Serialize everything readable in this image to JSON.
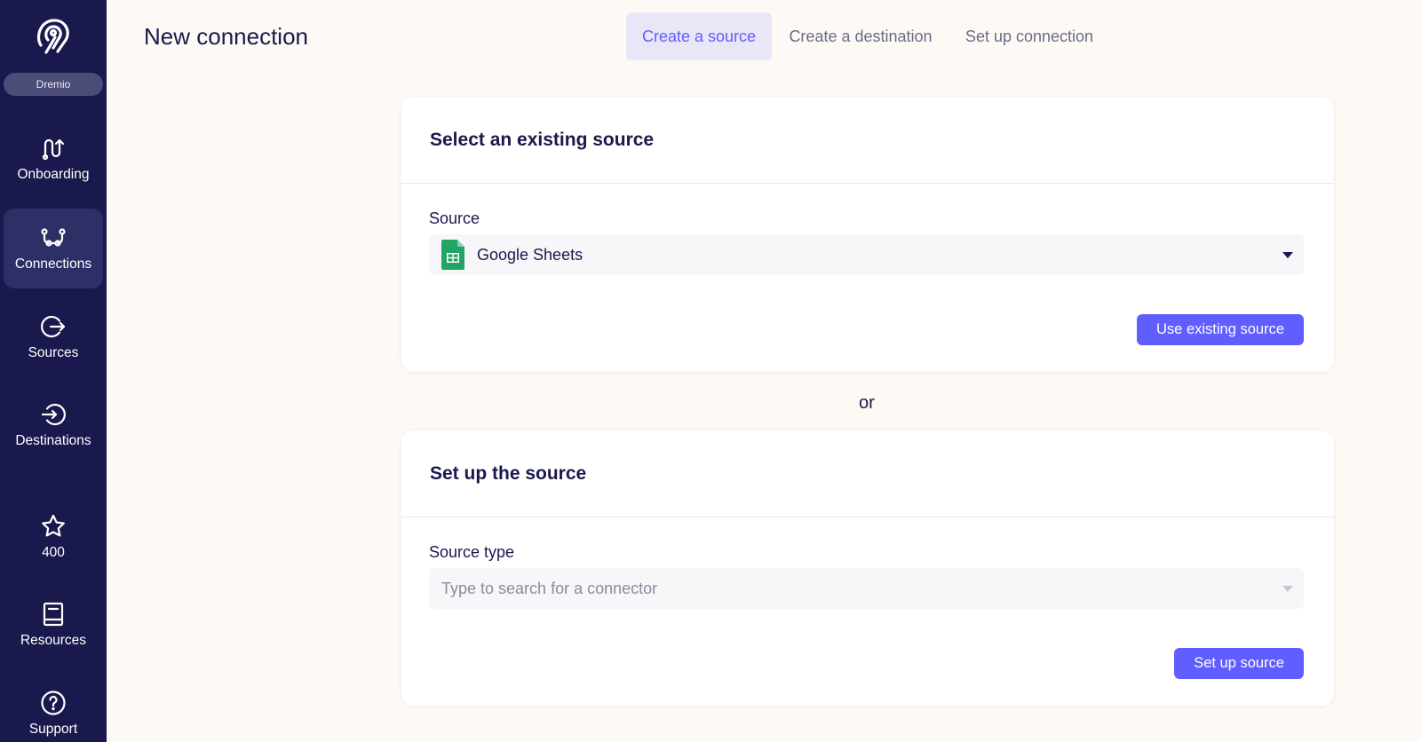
{
  "sidebar": {
    "workspace": "Dremio",
    "items": [
      {
        "label": "Onboarding",
        "icon": "onboarding-icon"
      },
      {
        "label": "Connections",
        "icon": "connections-icon",
        "active": true
      },
      {
        "label": "Sources",
        "icon": "sources-icon"
      },
      {
        "label": "Destinations",
        "icon": "destinations-icon"
      },
      {
        "label": "400",
        "icon": "star-icon"
      },
      {
        "label": "Resources",
        "icon": "book-icon"
      },
      {
        "label": "Support",
        "icon": "help-icon"
      }
    ]
  },
  "header": {
    "title": "New connection",
    "steps": [
      {
        "label": "Create a source",
        "active": true
      },
      {
        "label": "Create a destination",
        "active": false
      },
      {
        "label": "Set up connection",
        "active": false
      }
    ]
  },
  "existing_source": {
    "title": "Select an existing source",
    "field_label": "Source",
    "selected_value": "Google Sheets",
    "selected_icon": "google-sheets-icon",
    "button_label": "Use existing source"
  },
  "divider_text": "or",
  "new_source": {
    "title": "Set up the source",
    "field_label": "Source type",
    "placeholder": "Type to search for a connector",
    "button_label": "Set up source"
  },
  "colors": {
    "sidebar_bg": "#1a194d",
    "accent": "#615eff",
    "page_bg": "#fdf9f4",
    "sheets_green": "#21a464"
  }
}
